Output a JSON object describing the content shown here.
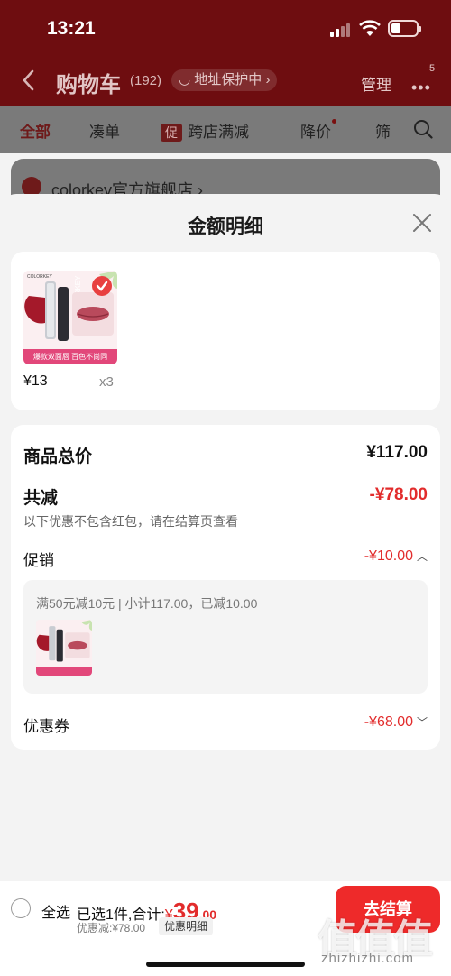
{
  "status_bar": {
    "time": "13:21"
  },
  "nav": {
    "title": "购物车",
    "count": "(192)",
    "address_pill": "地址保护中",
    "manage": "管理",
    "message_badge": "5"
  },
  "tabs": {
    "all": "全部",
    "bundle": "凑单",
    "cross_store_tag": "促",
    "cross_store": "跨店满减",
    "price_drop": "降价",
    "filter": "筛"
  },
  "shop": {
    "name": "colorkey官方旗舰店 ›"
  },
  "sheet": {
    "title": "金额明细",
    "product": {
      "price": "¥13",
      "quantity": "x3",
      "brand_mark": "COLORKEY",
      "image_band": "爆款双面唇 百色不尚同"
    },
    "goods_total_label": "商品总价",
    "goods_total_value": "¥117.00",
    "discount_label": "共减",
    "discount_value": "-¥78.00",
    "discount_note": "以下优惠不包含红包，请在结算页查看",
    "promotion": {
      "label": "促销",
      "value": "-¥10.00",
      "rule_text": "满50元减10元 | 小计117.00，已减10.00"
    },
    "coupon": {
      "label": "优惠券",
      "value": "-¥68.00"
    }
  },
  "bottom_bar": {
    "select_all": "全选",
    "selected_text": "已选1件,合计:",
    "currency": "¥",
    "total_int": "39",
    "total_dec": ".00",
    "saving": "优惠减:¥78.00",
    "detail_button": "优惠明细",
    "checkout_button": "去结算"
  },
  "watermark": {
    "logo": "值值值",
    "text": "zhizhizhi.com"
  },
  "colors": {
    "accent_red": "#e22c2c",
    "checkout_red": "#ee2a2a",
    "header_bg": "#6e0d10"
  }
}
